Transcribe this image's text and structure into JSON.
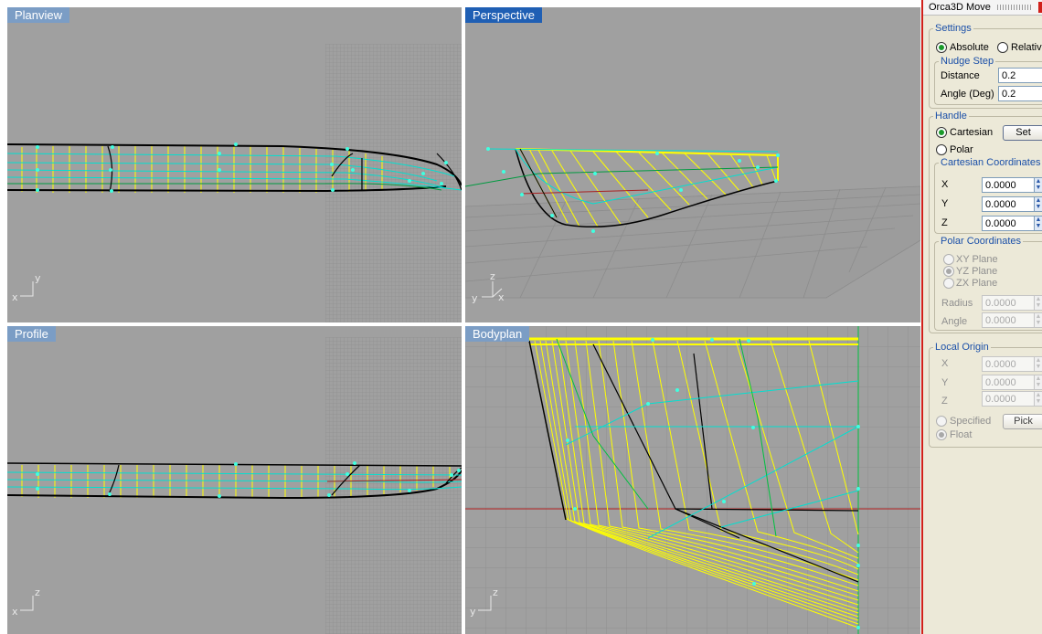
{
  "viewports": {
    "planview": {
      "label": "Planview",
      "axis_h": "x",
      "axis_v": "y"
    },
    "perspective": {
      "label": "Perspective",
      "axis_h": "x",
      "axis_v": "z",
      "axis_origin": "y"
    },
    "profile": {
      "label": "Profile",
      "axis_h": "x",
      "axis_v": "z"
    },
    "bodyplan": {
      "label": "Bodyplan",
      "axis_h": "y",
      "axis_v": "z"
    }
  },
  "panel": {
    "title": "Orca3D Move",
    "settings": {
      "legend": "Settings",
      "absolute_label": "Absolute",
      "relative_label": "Relative",
      "nudge": {
        "legend": "Nudge Step",
        "distance_label": "Distance",
        "distance_value": "0.2",
        "angle_label": "Angle (Deg)",
        "angle_value": "0.2"
      }
    },
    "handle": {
      "legend": "Handle",
      "cartesian_label": "Cartesian",
      "set_label": "Set",
      "polar_label": "Polar",
      "cartesian": {
        "legend": "Cartesian Coordinates",
        "x_label": "X",
        "x_value": "0.0000",
        "y_label": "Y",
        "y_value": "0.0000",
        "z_label": "Z",
        "z_value": "0.0000"
      },
      "polar": {
        "legend": "Polar Coordinates",
        "xy_label": "XY Plane",
        "yz_label": "YZ Plane",
        "zx_label": "ZX Plane",
        "radius_label": "Radius",
        "radius_value": "0.0000",
        "angle_label": "Angle",
        "angle_value": "0.0000"
      }
    },
    "local_origin": {
      "legend": "Local Origin",
      "x_label": "X",
      "x_value": "0.0000",
      "y_label": "Y",
      "y_value": "0.0000",
      "z_label": "Z",
      "z_value": "0.0000",
      "specified_label": "Specified",
      "pick_label": "Pick",
      "float_label": "Float"
    }
  },
  "colors": {
    "viewport_bg": "#a0a0a0",
    "active_label": "#1f5fb4",
    "inactive_label": "#7b9dc5",
    "section_line": "#ffff00",
    "control_point": "#40ffe0",
    "panel_border": "#d0201a"
  }
}
